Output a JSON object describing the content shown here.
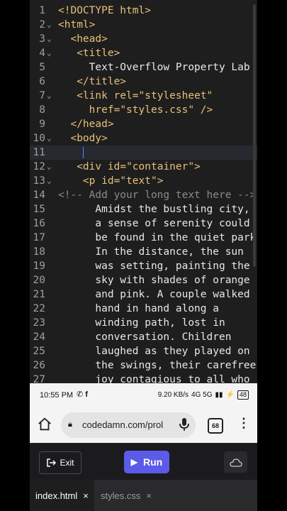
{
  "editor": {
    "lines": [
      {
        "n": "1",
        "fold": "",
        "parts": [
          [
            "tag",
            "<!DOCTYPE html>"
          ]
        ]
      },
      {
        "n": "2",
        "fold": "v",
        "parts": [
          [
            "tag",
            "<html>"
          ]
        ]
      },
      {
        "n": "3",
        "fold": "v",
        "parts": [
          [
            "txt",
            "  "
          ],
          [
            "tag",
            "<head>"
          ]
        ]
      },
      {
        "n": "4",
        "fold": "v",
        "parts": [
          [
            "txt",
            "   "
          ],
          [
            "tag",
            "<title>"
          ]
        ]
      },
      {
        "n": "5",
        "fold": "",
        "parts": [
          [
            "txt",
            "     Text-Overflow Property Lab"
          ]
        ]
      },
      {
        "n": "6",
        "fold": "",
        "parts": [
          [
            "txt",
            "   "
          ],
          [
            "tag",
            "</title>"
          ]
        ]
      },
      {
        "n": "7",
        "fold": "v",
        "parts": [
          [
            "txt",
            "   "
          ],
          [
            "tag",
            "<link "
          ],
          [
            "attr",
            "rel="
          ],
          [
            "str",
            "\"stylesheet\""
          ]
        ]
      },
      {
        "n": "8",
        "fold": "",
        "parts": [
          [
            "txt",
            "     "
          ],
          [
            "attr",
            "href="
          ],
          [
            "str",
            "\"styles.css\""
          ],
          [
            "tag",
            " />"
          ]
        ]
      },
      {
        "n": "9",
        "fold": "",
        "parts": [
          [
            "txt",
            "  "
          ],
          [
            "tag",
            "</head>"
          ]
        ]
      },
      {
        "n": "10",
        "fold": "v",
        "parts": [
          [
            "txt",
            "  "
          ],
          [
            "tag",
            "<body>"
          ]
        ]
      },
      {
        "n": "11",
        "fold": "",
        "parts": [
          [
            "txt",
            "    "
          ],
          [
            "cursor",
            ""
          ]
        ],
        "active": true
      },
      {
        "n": "12",
        "fold": "v",
        "parts": [
          [
            "txt",
            "   "
          ],
          [
            "tag",
            "<div "
          ],
          [
            "attr",
            "id="
          ],
          [
            "str",
            "\"container\""
          ],
          [
            "tag",
            ">"
          ]
        ]
      },
      {
        "n": "13",
        "fold": "v",
        "parts": [
          [
            "txt",
            "    "
          ],
          [
            "tag",
            "<p "
          ],
          [
            "attr",
            "id="
          ],
          [
            "str",
            "\"text\""
          ],
          [
            "tag",
            ">"
          ]
        ]
      },
      {
        "n": "14",
        "fold": "",
        "parts": [
          [
            "cmt",
            "<!-- Add your long text here -->"
          ]
        ]
      },
      {
        "n": "15",
        "fold": "",
        "parts": [
          [
            "txt",
            "      Amidst the bustling city,"
          ]
        ]
      },
      {
        "n": "16",
        "fold": "",
        "parts": [
          [
            "txt",
            "      a sense of serenity could"
          ]
        ]
      },
      {
        "n": "17",
        "fold": "",
        "parts": [
          [
            "txt",
            "      be found in the quiet park."
          ]
        ]
      },
      {
        "n": "18",
        "fold": "",
        "parts": [
          [
            "txt",
            "      In the distance, the sun"
          ]
        ]
      },
      {
        "n": "19",
        "fold": "",
        "parts": [
          [
            "txt",
            "      was setting, painting the"
          ]
        ]
      },
      {
        "n": "20",
        "fold": "",
        "parts": [
          [
            "txt",
            "      sky with shades of orange"
          ]
        ]
      },
      {
        "n": "21",
        "fold": "",
        "parts": [
          [
            "txt",
            "      and pink. A couple walked"
          ]
        ]
      },
      {
        "n": "22",
        "fold": "",
        "parts": [
          [
            "txt",
            "      hand in hand along a"
          ]
        ]
      },
      {
        "n": "23",
        "fold": "",
        "parts": [
          [
            "txt",
            "      winding path, lost in"
          ]
        ]
      },
      {
        "n": "24",
        "fold": "",
        "parts": [
          [
            "txt",
            "      conversation. Children"
          ]
        ]
      },
      {
        "n": "25",
        "fold": "",
        "parts": [
          [
            "txt",
            "      laughed as they played on"
          ]
        ]
      },
      {
        "n": "26",
        "fold": "",
        "parts": [
          [
            "txt",
            "      the swings, their carefree"
          ]
        ]
      },
      {
        "n": "27",
        "fold": "",
        "parts": [
          [
            "txt",
            "      joy contagious to all who"
          ]
        ]
      }
    ]
  },
  "status": {
    "time": "10:55 PM",
    "signal": "4G 5G",
    "speed": "9.20 KB/s",
    "battery": "48"
  },
  "browser": {
    "url": "codedamn.com/prol",
    "tab_count": "68"
  },
  "toolbar": {
    "exit_label": "Exit",
    "run_label": "Run"
  },
  "tabs": [
    {
      "label": "index.html",
      "close": "×"
    },
    {
      "label": "styles.css",
      "close": "×"
    }
  ],
  "colors": {
    "accent": "#5b5be8",
    "editor_bg": "#1e1e1e",
    "code_tag": "#e6c07b"
  }
}
